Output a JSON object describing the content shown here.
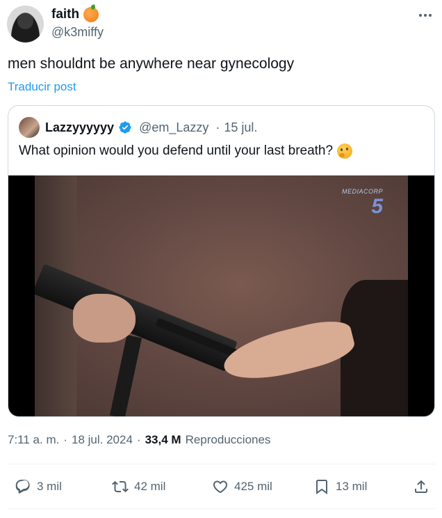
{
  "author": {
    "display_name": "faith",
    "handle": "@k3miffy",
    "name_emoji": "orange-emoji"
  },
  "tweet": {
    "text": "men shouldnt be anywhere near gynecology",
    "translate_label": "Traducir post"
  },
  "quoted": {
    "display_name": "Lazzyyyyyy",
    "handle": "@em_Lazzy",
    "separator": "·",
    "date": "15 jul.",
    "text": "What opinion would you defend until your last breath?",
    "text_emoji": "thinking-face-emoji",
    "video": {
      "channel_name": "MEDIACORP",
      "channel_number": "5"
    }
  },
  "meta": {
    "time": "7:11 a. m.",
    "sep1": "·",
    "date": "18 jul. 2024",
    "sep2": "·",
    "views_count": "33,4 M",
    "views_label": "Reproducciones"
  },
  "actions": {
    "replies": "3 mil",
    "reposts": "42 mil",
    "likes": "425 mil",
    "bookmarks": "13 mil"
  },
  "colors": {
    "accent": "#1d9bf0",
    "secondary_text": "#536471",
    "primary_text": "#0f1419",
    "border": "#cfd9de"
  }
}
